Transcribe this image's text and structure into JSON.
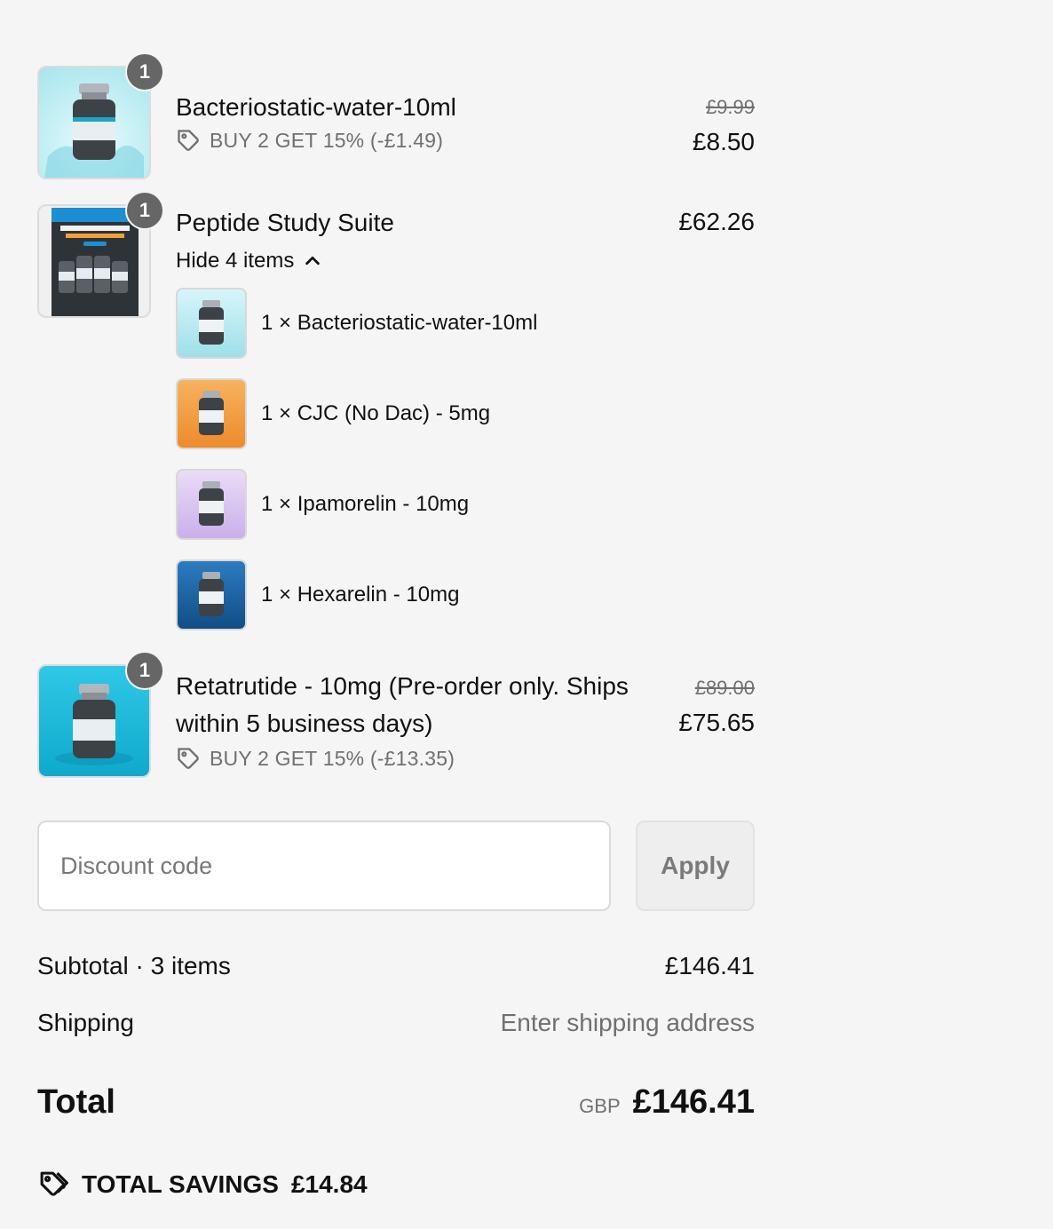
{
  "items": [
    {
      "title": "Bacteriostatic-water-10ml",
      "quantity": "1",
      "promo": "BUY 2 GET 15% (-£1.49)",
      "price_original": "£9.99",
      "price": "£8.50",
      "image_bg": "#bfeef3"
    },
    {
      "title": "Peptide Study Suite",
      "quantity": "1",
      "price": "£62.26",
      "toggle_label": "Hide 4 items",
      "image_bg": "#3a3f46",
      "components": [
        {
          "label": "1 × Bacteriostatic-water-10ml",
          "bg": "#bdeef5"
        },
        {
          "label": "1 × CJC (No Dac) - 5mg",
          "bg": "#f29a3a"
        },
        {
          "label": "1 × Ipamorelin - 10mg",
          "bg": "#d9c6ef"
        },
        {
          "label": "1 × Hexarelin - 10mg",
          "bg": "#1f66a8"
        }
      ]
    },
    {
      "title_line1": "Retatrutide - 10mg (Pre-order only. Ships",
      "title_line2": "within 5 business days)",
      "quantity": "1",
      "promo": "BUY 2 GET 15% (-£13.35)",
      "price_original": "£89.00",
      "price": "£75.65",
      "image_bg": "#17b7d6"
    }
  ],
  "discount": {
    "placeholder": "Discount code",
    "apply_label": "Apply"
  },
  "summary": {
    "subtotal_label": "Subtotal · 3 items",
    "subtotal_value": "£146.41",
    "shipping_label": "Shipping",
    "shipping_value": "Enter shipping address",
    "total_label": "Total",
    "currency": "GBP",
    "total_value": "£146.41",
    "savings_label": "TOTAL SAVINGS",
    "savings_value": "£14.84"
  },
  "icons": {
    "tag": "tag-icon",
    "chevron": "chevron-up-icon",
    "savings": "double-tag-icon"
  }
}
